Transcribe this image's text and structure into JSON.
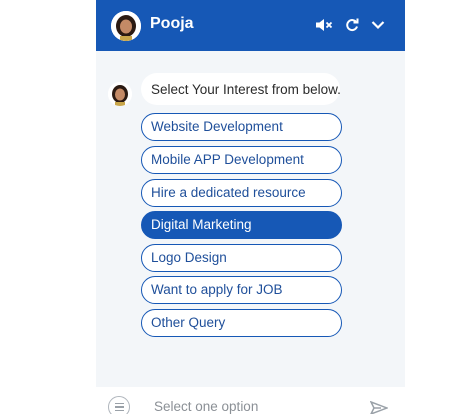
{
  "header": {
    "agent_name": "Pooja",
    "icons": [
      "mute-icon",
      "refresh-icon",
      "chevron-down-icon"
    ],
    "background": "#1658b6"
  },
  "message": {
    "text": "Select Your Interest from below."
  },
  "options": [
    {
      "label": "Website Development",
      "selected": false
    },
    {
      "label": "Mobile APP Development",
      "selected": false
    },
    {
      "label": "Hire a dedicated resource",
      "selected": false
    },
    {
      "label": "Digital Marketing",
      "selected": true
    },
    {
      "label": "Logo Design",
      "selected": false
    },
    {
      "label": "Want to apply for JOB",
      "selected": false
    },
    {
      "label": "Other Query",
      "selected": false
    }
  ],
  "footer": {
    "placeholder": "Select one option",
    "icons": [
      "menu-icon",
      "send-icon"
    ]
  },
  "colors": {
    "accent": "#1658b6",
    "panel_bg": "#f3f6f9",
    "option_text": "#1f4f9a"
  }
}
